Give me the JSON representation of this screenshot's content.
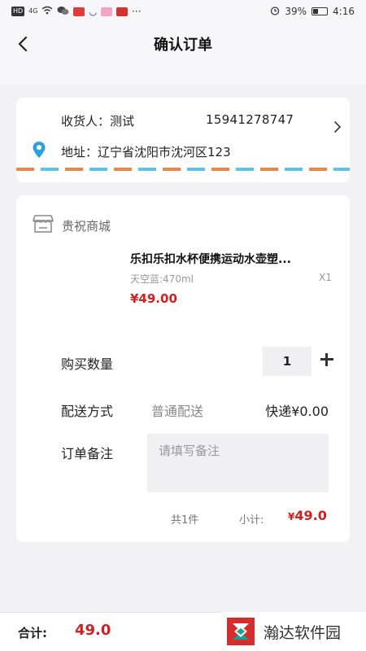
{
  "status_bar": {
    "left_indicators": [
      "HD",
      "4G"
    ],
    "battery": "39%",
    "time": "4:16"
  },
  "nav": {
    "title": "确认订单"
  },
  "address": {
    "recipient_label": "收货人：",
    "recipient_name": "测试",
    "phone": "15941278747",
    "address_label": "地址：",
    "address_value": "辽宁省沈阳市沈河区123"
  },
  "order": {
    "shop_name": "贵祝商城",
    "product_name": "乐扣乐扣水杯便携运动水壶塑...",
    "product_spec": "天空蓝:470ml",
    "product_qty": "X1",
    "product_price": "¥49.00",
    "quantity_label": "购买数量",
    "quantity_value": "1",
    "delivery_label": "配送方式",
    "delivery_method": "普通配送",
    "delivery_fee": "快递¥0.00",
    "remark_label": "订单备注",
    "remark_placeholder": "请填写备注",
    "count_text": "共1件",
    "subtotal_label": "小计:",
    "subtotal_currency": "¥",
    "subtotal_value": "49.0"
  },
  "bottom": {
    "total_label": "合计:",
    "total_value": "49.0"
  },
  "watermark": {
    "text": "瀚达软件园"
  },
  "colors": {
    "accent_red": "#d12020",
    "stripe_orange": "#e8874a",
    "stripe_blue": "#5bc4e6",
    "pin_blue": "#2aa3e0"
  }
}
